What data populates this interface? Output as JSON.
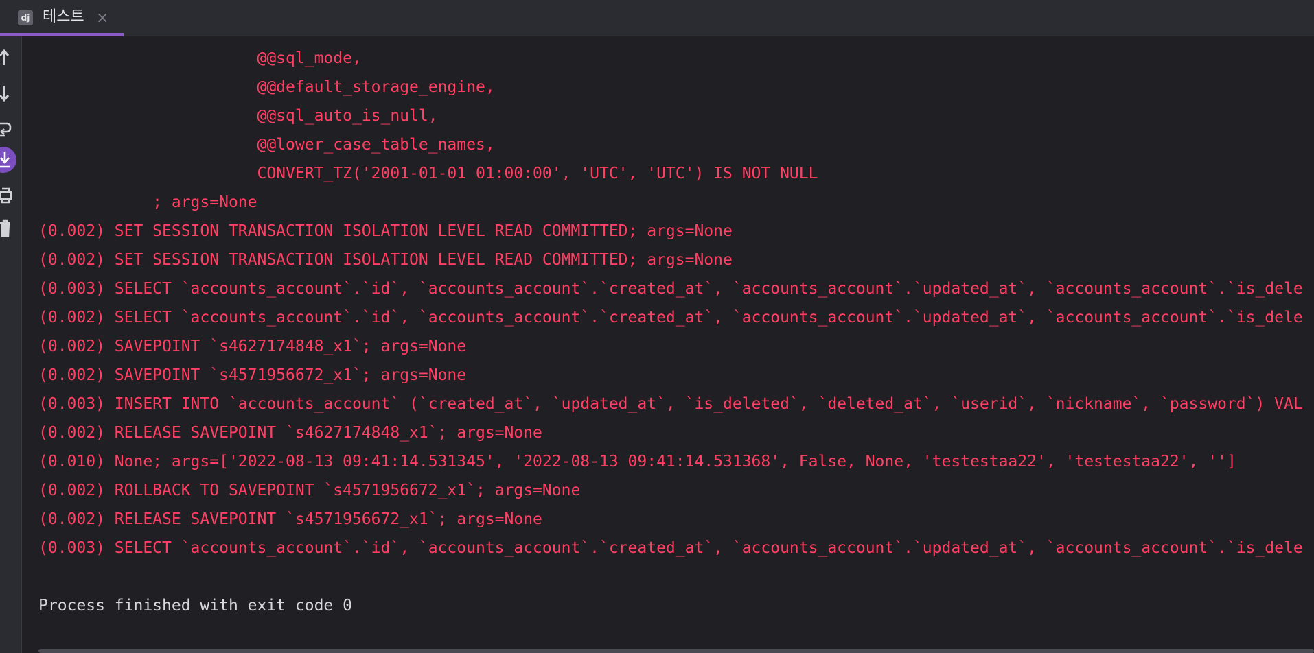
{
  "tab": {
    "icon_text": "dj",
    "label": "테스트",
    "close_glyph": "×"
  },
  "toolbar": {
    "items": [
      {
        "name": "up-arrow-icon"
      },
      {
        "name": "down-arrow-icon"
      },
      {
        "name": "soft-wrap-icon"
      },
      {
        "name": "scroll-to-end-icon",
        "active": true
      },
      {
        "name": "print-icon"
      },
      {
        "name": "trash-icon"
      }
    ]
  },
  "console": {
    "lines": [
      {
        "text": "                       @@sql_mode,",
        "kind": "error"
      },
      {
        "text": "                       @@default_storage_engine,",
        "kind": "error"
      },
      {
        "text": "                       @@sql_auto_is_null,",
        "kind": "error"
      },
      {
        "text": "                       @@lower_case_table_names,",
        "kind": "error"
      },
      {
        "text": "                       CONVERT_TZ('2001-01-01 01:00:00', 'UTC', 'UTC') IS NOT NULL",
        "kind": "error"
      },
      {
        "text": "            ; args=None",
        "kind": "error"
      },
      {
        "text": "(0.002) SET SESSION TRANSACTION ISOLATION LEVEL READ COMMITTED; args=None",
        "kind": "error"
      },
      {
        "text": "(0.002) SET SESSION TRANSACTION ISOLATION LEVEL READ COMMITTED; args=None",
        "kind": "error"
      },
      {
        "text": "(0.003) SELECT `accounts_account`.`id`, `accounts_account`.`created_at`, `accounts_account`.`updated_at`, `accounts_account`.`is_dele",
        "kind": "error"
      },
      {
        "text": "(0.002) SELECT `accounts_account`.`id`, `accounts_account`.`created_at`, `accounts_account`.`updated_at`, `accounts_account`.`is_dele",
        "kind": "error"
      },
      {
        "text": "(0.002) SAVEPOINT `s4627174848_x1`; args=None",
        "kind": "error"
      },
      {
        "text": "(0.002) SAVEPOINT `s4571956672_x1`; args=None",
        "kind": "error"
      },
      {
        "text": "(0.003) INSERT INTO `accounts_account` (`created_at`, `updated_at`, `is_deleted`, `deleted_at`, `userid`, `nickname`, `password`) VAL",
        "kind": "error"
      },
      {
        "text": "(0.002) RELEASE SAVEPOINT `s4627174848_x1`; args=None",
        "kind": "error"
      },
      {
        "text": "(0.010) None; args=['2022-08-13 09:41:14.531345', '2022-08-13 09:41:14.531368', False, None, 'testestaa22', 'testestaa22', '']",
        "kind": "error"
      },
      {
        "text": "(0.002) ROLLBACK TO SAVEPOINT `s4571956672_x1`; args=None",
        "kind": "error"
      },
      {
        "text": "(0.002) RELEASE SAVEPOINT `s4571956672_x1`; args=None",
        "kind": "error"
      },
      {
        "text": "(0.003) SELECT `accounts_account`.`id`, `accounts_account`.`created_at`, `accounts_account`.`updated_at`, `accounts_account`.`is_dele",
        "kind": "error"
      },
      {
        "text": "Process finished with exit code 0",
        "kind": "normal"
      }
    ]
  },
  "colors": {
    "error_text": "#ff3f63",
    "normal_text": "#d8d8dc",
    "accent": "#8b5cc8",
    "background": "#1f1f24"
  }
}
